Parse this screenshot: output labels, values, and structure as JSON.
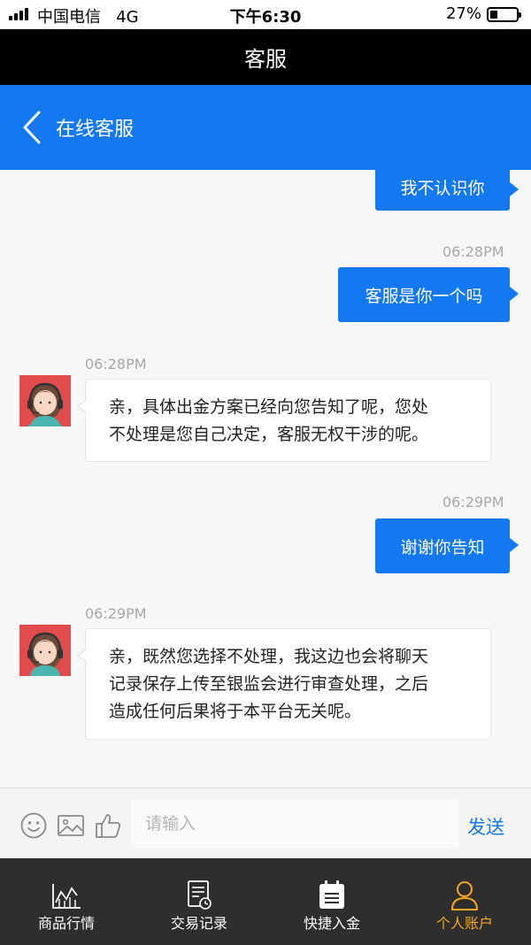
{
  "status_bar": {
    "carrier": "中国电信   4G",
    "time": "下午6:30",
    "battery_percent": "27%",
    "battery_level": 0.27
  },
  "title_bar": {
    "title": "客服"
  },
  "header": {
    "back_icon": "chevron-left-icon",
    "title": "在线客服"
  },
  "messages": [
    {
      "side": "right",
      "text": "我不认识你"
    },
    {
      "side": "right",
      "time": "06:28PM",
      "text": "客服是你一个吗"
    },
    {
      "side": "left",
      "time": "06:28PM",
      "lines": [
        "亲，具体出金方案已经向您告知了呢，您处",
        "不处理是您自己决定，客服无权干涉的呢。"
      ]
    },
    {
      "side": "right",
      "time": "06:29PM",
      "text": "谢谢你告知"
    },
    {
      "side": "left",
      "time": "06:29PM",
      "lines": [
        "亲，既然您选择不处理，我这边也会将聊天",
        "记录保存上传至银监会进行审查处理，之后",
        "造成任何后果将于本平台无关呢。"
      ]
    }
  ],
  "input_bar": {
    "icons": [
      "emoji-icon",
      "image-icon",
      "thumbs-up-icon"
    ],
    "placeholder": "请输入",
    "send_label": "发送"
  },
  "bottom_nav": {
    "items": [
      {
        "label": "商品行情",
        "icon": "chart-icon"
      },
      {
        "label": "交易记录",
        "icon": "receipt-icon"
      },
      {
        "label": "快捷入金",
        "icon": "calendar-icon"
      },
      {
        "label": "个人账户",
        "icon": "user-icon",
        "active": true
      }
    ]
  },
  "colors": {
    "accent": "#1478f0",
    "nav_active": "#f5a623",
    "nav_bg": "#2e2e2e"
  }
}
